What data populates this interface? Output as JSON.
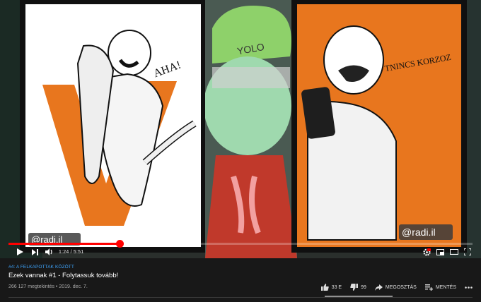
{
  "player": {
    "time_display": "1:24 / 5:51",
    "progress_fraction": 0.24,
    "watermark_left": "@radi.il",
    "watermark_right": "@radi.il",
    "cap_text": "YOLO",
    "handwritten_left": "AHA!",
    "handwritten_right": "TNINCS KORZOZ"
  },
  "video": {
    "hashtag": "#4: A FELKAPOTTAK KÖZÖTT",
    "title": "Ezek vannak #1 - Folytassuk tovább!",
    "stats": "266 127 megtekintés • 2019. dec. 7."
  },
  "actions": {
    "like_count": "33 E",
    "dislike_count": "99",
    "share_label": "MEGOSZTÁS",
    "save_label": "MENTÉS"
  },
  "colors": {
    "progress": "#ff0000",
    "link": "#3ea6ff",
    "orange": "#e8761e",
    "background": "#181818"
  }
}
